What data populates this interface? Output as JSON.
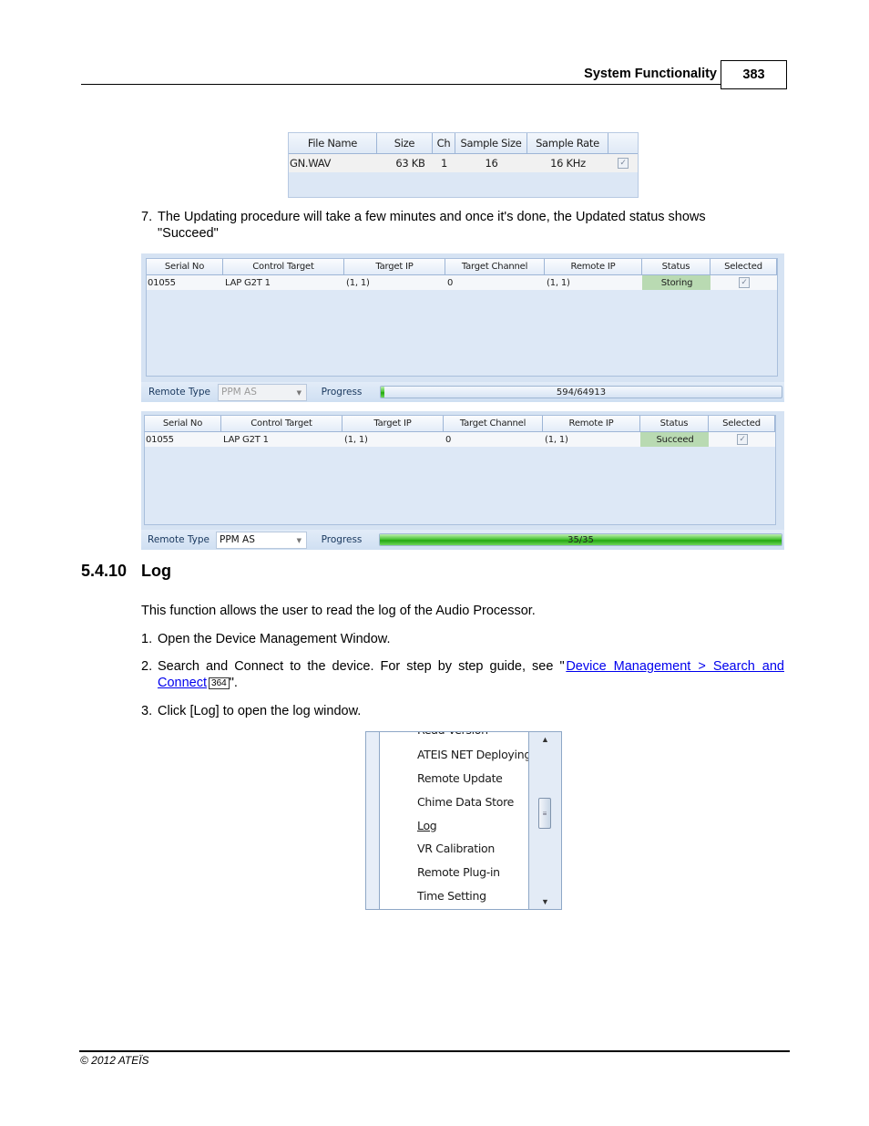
{
  "header": {
    "section_title": "System Functionality",
    "page_number": "383"
  },
  "file_table": {
    "columns": [
      "File Name",
      "Size",
      "Ch",
      "Sample Size",
      "Sample Rate",
      ""
    ],
    "rows": [
      {
        "file_name": "GN.WAV",
        "size": "63 KB",
        "ch": "1",
        "sample_size": "16",
        "sample_rate": "16 KHz",
        "checked": true
      }
    ]
  },
  "steps_top": {
    "step7": {
      "num": "7.",
      "text_line1": "The Updating procedure will take a few minutes and once it's done, the Updated status shows",
      "text_line2": "\"Succeed\""
    }
  },
  "device_panels": [
    {
      "columns": [
        "Serial No",
        "Control Target",
        "Target IP",
        "Target Channel",
        "Remote IP",
        "Status",
        "Selected"
      ],
      "row": {
        "serial_no": "01055",
        "control_target": "LAP G2T 1",
        "target_ip": "(1, 1)",
        "target_channel": "0",
        "remote_ip": "(1, 1)",
        "status": "Storing",
        "selected": true
      },
      "remote_type_label": "Remote Type",
      "remote_type_value": "PPM AS",
      "remote_type_enabled": false,
      "progress_label": "Progress",
      "progress_text": "594/64913",
      "progress_current": 594,
      "progress_total": 64913
    },
    {
      "columns": [
        "Serial No",
        "Control Target",
        "Target IP",
        "Target Channel",
        "Remote IP",
        "Status",
        "Selected"
      ],
      "row": {
        "serial_no": "01055",
        "control_target": "LAP G2T 1",
        "target_ip": "(1, 1)",
        "target_channel": "0",
        "remote_ip": "(1, 1)",
        "status": "Succeed",
        "selected": true
      },
      "remote_type_label": "Remote Type",
      "remote_type_value": "PPM AS",
      "remote_type_enabled": true,
      "progress_label": "Progress",
      "progress_text": "35/35",
      "progress_current": 35,
      "progress_total": 35
    }
  ],
  "section": {
    "number": "5.4.10",
    "title": "Log"
  },
  "intro": "This function allows the user to read the log of the Audio Processor.",
  "steps": {
    "step1": {
      "num": "1.",
      "text": "Open the Device Management Window."
    },
    "step2": {
      "num": "2.",
      "text_before": "Search and Connect to the device. For step by step guide, see \"",
      "link_line1": "Device Management > Search and",
      "link_line2": "Connect",
      "page_ref": "364",
      "text_after": "\"."
    },
    "step3": {
      "num": "3.",
      "text": "Click [Log] to open the log window."
    }
  },
  "menu": {
    "items": [
      "Read Version",
      "ATEIS NET Deploying",
      "Remote Update",
      "Chime Data Store",
      "Log",
      "VR Calibration",
      "Remote Plug-in",
      "Time Setting"
    ],
    "highlighted": "Log"
  },
  "footer": {
    "copyright": "© 2012 ATEÏS"
  },
  "colors": {
    "link": "#0000ee",
    "status_ok": "#b9dab2",
    "progress_green": "#3fbf2a",
    "panel_bg": "#d6e3f3"
  }
}
